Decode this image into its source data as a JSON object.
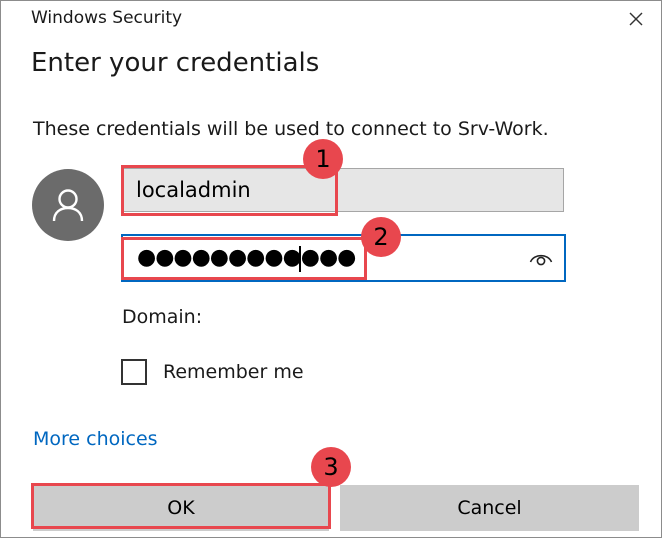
{
  "window": {
    "title": "Windows Security",
    "close_icon": "close-icon"
  },
  "dialog": {
    "heading": "Enter your credentials",
    "description": "These credentials will be used to connect to Srv-Work."
  },
  "avatar": {
    "icon": "user-icon"
  },
  "username": {
    "value": "localadmin"
  },
  "password": {
    "masked_value": "●●●●●●●●●●●●",
    "reveal_icon": "eye-icon"
  },
  "domain": {
    "label": "Domain:"
  },
  "remember": {
    "label": "Remember me",
    "checked": false
  },
  "more_choices": {
    "label": "More choices"
  },
  "buttons": {
    "ok": "OK",
    "cancel": "Cancel"
  },
  "annotations": {
    "color": "#e8474e",
    "steps": [
      "1",
      "2",
      "3"
    ]
  }
}
